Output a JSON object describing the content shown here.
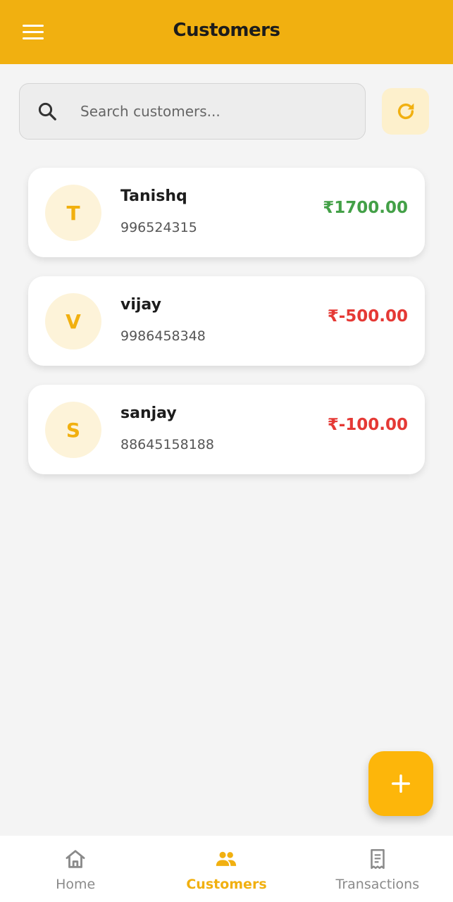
{
  "header": {
    "title": "Customers",
    "menu_icon": "menu-icon"
  },
  "search": {
    "placeholder": "Search customers...",
    "value": "",
    "icon": "search-icon"
  },
  "refresh": {
    "icon": "refresh-icon"
  },
  "colors": {
    "accent": "#f1b010",
    "positive": "#43a047",
    "negative": "#e53935",
    "avatar_bg": "#fdf3d9"
  },
  "customers": [
    {
      "initial": "T",
      "name": "Tanishq",
      "phone": "996524315",
      "balance": "₹1700.00",
      "balance_type": "positive"
    },
    {
      "initial": "V",
      "name": "vijay",
      "phone": "9986458348",
      "balance": "₹-500.00",
      "balance_type": "negative"
    },
    {
      "initial": "S",
      "name": "sanjay",
      "phone": "88645158188",
      "balance": "₹-100.00",
      "balance_type": "negative"
    }
  ],
  "fab": {
    "icon": "plus-icon"
  },
  "bottom_nav": [
    {
      "label": "Home",
      "icon": "home-icon",
      "active": false
    },
    {
      "label": "Customers",
      "icon": "people-icon",
      "active": true
    },
    {
      "label": "Transactions",
      "icon": "receipt-icon",
      "active": false
    }
  ]
}
